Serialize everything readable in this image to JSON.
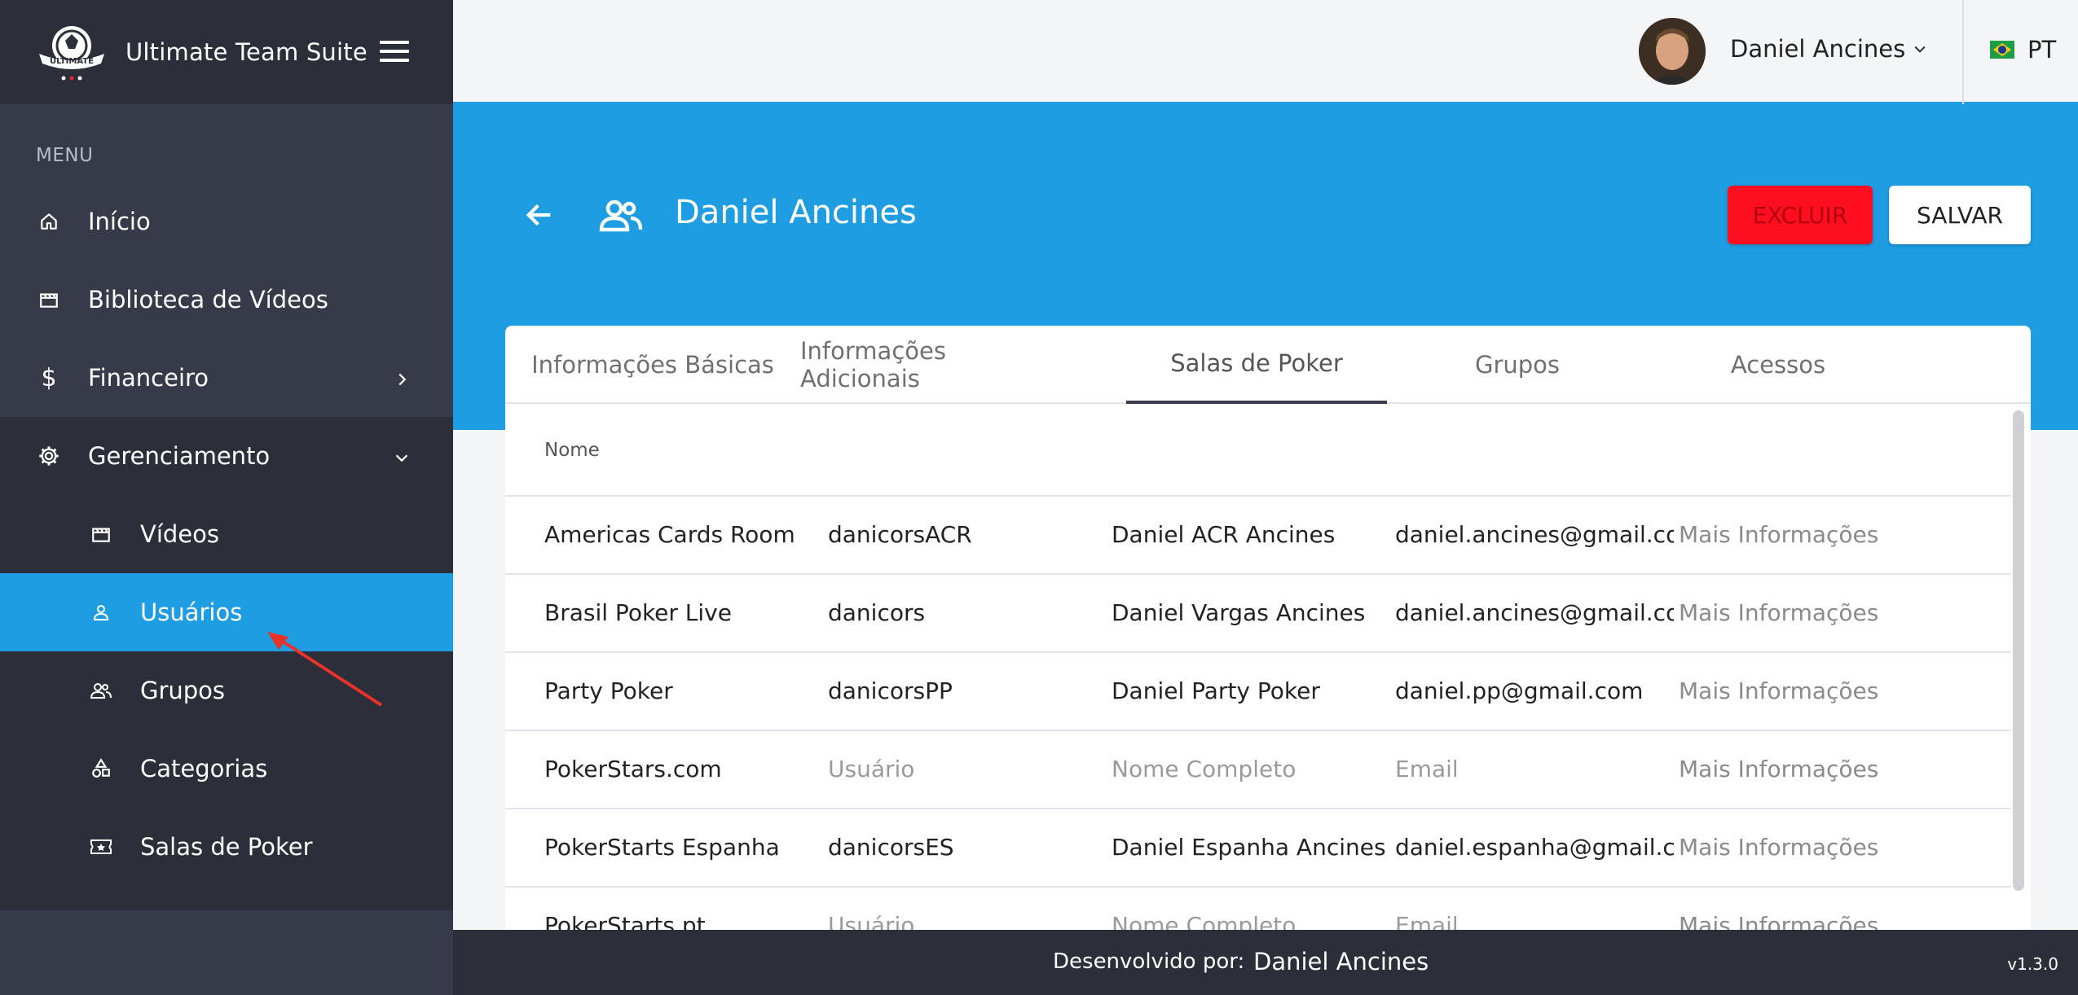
{
  "app": {
    "title": "Ultimate Team Suite",
    "logo_text": "ULTIMATE"
  },
  "sidebar": {
    "menu_label": "MENU",
    "items": [
      {
        "label": "Início",
        "icon": "home-icon"
      },
      {
        "label": "Biblioteca de Vídeos",
        "icon": "film-icon"
      },
      {
        "label": "Financeiro",
        "icon": "dollar-icon"
      },
      {
        "label": "Gerenciamento",
        "icon": "gear-icon"
      },
      {
        "label": "Vídeos",
        "icon": "film-icon"
      },
      {
        "label": "Usuários",
        "icon": "user-icon"
      },
      {
        "label": "Grupos",
        "icon": "group-icon"
      },
      {
        "label": "Categorias",
        "icon": "shapes-icon"
      },
      {
        "label": "Salas de Poker",
        "icon": "ticket-icon"
      }
    ]
  },
  "topbar": {
    "user_name": "Daniel Ancines",
    "language": "PT"
  },
  "header": {
    "title": "Daniel Ancines",
    "delete_label": "EXCLUIR",
    "save_label": "SALVAR"
  },
  "tabs": [
    {
      "label": "Informações Básicas"
    },
    {
      "label": "Informações Adicionais"
    },
    {
      "label": "Salas de Poker"
    },
    {
      "label": "Grupos"
    },
    {
      "label": "Acessos"
    }
  ],
  "table": {
    "column_header": "Nome",
    "rows": [
      {
        "room": "Americas Cards Room",
        "user": "danicorsACR",
        "full_name": "Daniel ACR Ancines",
        "email": "daniel.ancines@gmail.com",
        "more": "Mais Informações"
      },
      {
        "room": "Brasil Poker Live",
        "user": "danicors",
        "full_name": "Daniel Vargas Ancines",
        "email": "daniel.ancines@gmail.com",
        "more": "Mais Informações"
      },
      {
        "room": "Party Poker",
        "user": "danicorsPP",
        "full_name": "Daniel Party Poker",
        "email": "daniel.pp@gmail.com",
        "more": "Mais Informações"
      },
      {
        "room": "PokerStars.com",
        "user": "Usuário",
        "full_name": "Nome Completo",
        "email": "Email",
        "more": "Mais Informações"
      },
      {
        "room": "PokerStarts Espanha",
        "user": "danicorsES",
        "full_name": "Daniel Espanha Ancines",
        "email": "daniel.espanha@gmail.com",
        "more": "Mais Informações"
      },
      {
        "room": "PokerStarts.pt",
        "user": "Usuário",
        "full_name": "Nome Completo",
        "email": "Email",
        "more": "Mais Informações"
      }
    ]
  },
  "footer": {
    "label": "Desenvolvido por:",
    "name": "Daniel Ancines",
    "version": "v1.3.0"
  },
  "colors": {
    "accent": "#1e9de3",
    "sidebar": "#373a48",
    "sidebar_dark": "#2c2e3a",
    "danger": "#fd0f1f"
  }
}
